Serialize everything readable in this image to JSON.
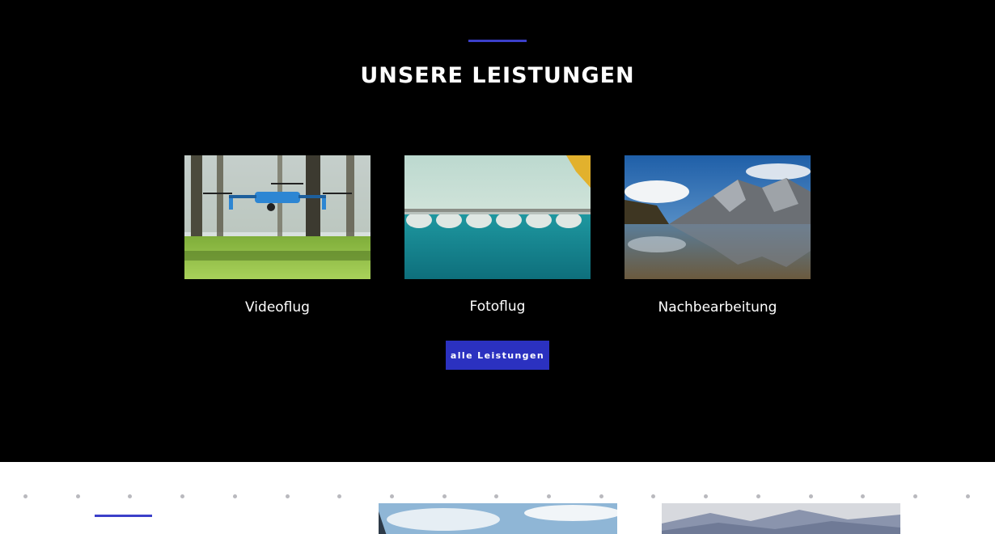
{
  "services_section": {
    "title": "UNSERE LEISTUNGEN",
    "accent_color": "#3b3fc9",
    "cards": [
      {
        "label": "Videoflug",
        "image": "drone-in-park-photo"
      },
      {
        "label": "Fotoflug",
        "image": "aerial-bridge-over-turquoise-water-photo"
      },
      {
        "label": "Nachbearbeitung",
        "image": "mountain-lake-reflection-photo"
      }
    ],
    "button_label": "alle Leistungen",
    "button_color": "#2b31c0"
  },
  "next_section": {
    "background": "#ffffff",
    "images": [
      "sky-and-clouds-photo",
      "misty-mountains-photo"
    ]
  }
}
